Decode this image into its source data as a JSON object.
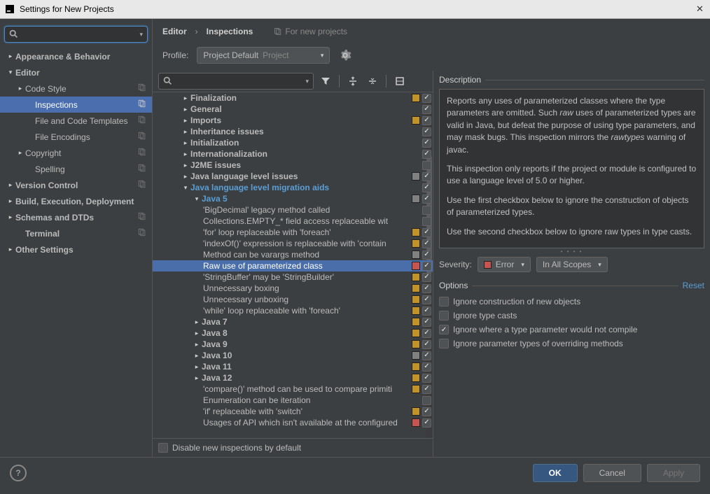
{
  "title": "Settings for New Projects",
  "crumbs": {
    "a": "Editor",
    "b": "Inspections",
    "sub": "For new projects"
  },
  "profile": {
    "label": "Profile:",
    "name": "Project Default",
    "scope": "Project"
  },
  "sidebar": {
    "items": [
      {
        "lbl": "Appearance & Behavior",
        "tri": "closed",
        "bold": true,
        "ind": 0,
        "copy": false
      },
      {
        "lbl": "Editor",
        "tri": "open",
        "bold": true,
        "ind": 0,
        "copy": false
      },
      {
        "lbl": "Code Style",
        "tri": "closed",
        "bold": false,
        "ind": 1,
        "copy": true
      },
      {
        "lbl": "Inspections",
        "tri": "none",
        "bold": false,
        "ind": 2,
        "sel": true,
        "copy": true
      },
      {
        "lbl": "File and Code Templates",
        "tri": "none",
        "bold": false,
        "ind": 2,
        "copy": true
      },
      {
        "lbl": "File Encodings",
        "tri": "none",
        "bold": false,
        "ind": 2,
        "copy": true
      },
      {
        "lbl": "Copyright",
        "tri": "closed",
        "bold": false,
        "ind": 1,
        "copy": true
      },
      {
        "lbl": "Spelling",
        "tri": "none",
        "bold": false,
        "ind": 2,
        "copy": true
      },
      {
        "lbl": "Version Control",
        "tri": "closed",
        "bold": true,
        "ind": 0,
        "copy": true
      },
      {
        "lbl": "Build, Execution, Deployment",
        "tri": "closed",
        "bold": true,
        "ind": 0,
        "copy": false
      },
      {
        "lbl": "Schemas and DTDs",
        "tri": "closed",
        "bold": true,
        "ind": 0,
        "copy": true
      },
      {
        "lbl": "Terminal",
        "tri": "none",
        "bold": true,
        "ind": 1,
        "copy": true
      },
      {
        "lbl": "Other Settings",
        "tri": "closed",
        "bold": true,
        "ind": 0,
        "copy": false
      }
    ]
  },
  "inspections": [
    {
      "d": 2,
      "tri": "closed",
      "lbl": "Finalization",
      "bold": true,
      "sev": "orange",
      "chk": true
    },
    {
      "d": 2,
      "tri": "closed",
      "lbl": "General",
      "bold": true,
      "sev": "none",
      "chk": true
    },
    {
      "d": 2,
      "tri": "closed",
      "lbl": "Imports",
      "bold": true,
      "sev": "orange",
      "chk": true
    },
    {
      "d": 2,
      "tri": "closed",
      "lbl": "Inheritance issues",
      "bold": true,
      "sev": "none",
      "chk": true
    },
    {
      "d": 2,
      "tri": "closed",
      "lbl": "Initialization",
      "bold": true,
      "sev": "none",
      "chk": true
    },
    {
      "d": 2,
      "tri": "closed",
      "lbl": "Internationalization",
      "bold": true,
      "sev": "none",
      "chk": true
    },
    {
      "d": 2,
      "tri": "closed",
      "lbl": "J2ME issues",
      "bold": true,
      "sev": "none",
      "chk": false
    },
    {
      "d": 2,
      "tri": "closed",
      "lbl": "Java language level issues",
      "bold": true,
      "sev": "gray",
      "chk": true
    },
    {
      "d": 2,
      "tri": "open",
      "lbl": "Java language level migration aids",
      "bold": true,
      "blue": true,
      "sev": "none",
      "chk": true
    },
    {
      "d": 3,
      "tri": "open",
      "lbl": "Java 5",
      "bold": true,
      "blue": true,
      "sev": "gray",
      "chk": true
    },
    {
      "d": 4,
      "lbl": "'BigDecimal' legacy method called",
      "sev": "none",
      "chk": false
    },
    {
      "d": 4,
      "lbl": "Collections.EMPTY_* field access replaceable wit",
      "sev": "none",
      "chk": false
    },
    {
      "d": 4,
      "lbl": "'for' loop replaceable with 'foreach'",
      "sev": "orange",
      "chk": true
    },
    {
      "d": 4,
      "lbl": "'indexOf()' expression is replaceable with 'contain",
      "sev": "orange",
      "chk": true
    },
    {
      "d": 4,
      "lbl": "Method can be varargs method",
      "sev": "gray",
      "chk": true
    },
    {
      "d": 4,
      "lbl": "Raw use of parameterized class",
      "sev": "red",
      "chk": true,
      "sel": true
    },
    {
      "d": 4,
      "lbl": "'StringBuffer' may be 'StringBuilder'",
      "sev": "orange",
      "chk": true
    },
    {
      "d": 4,
      "lbl": "Unnecessary boxing",
      "sev": "orange",
      "chk": true
    },
    {
      "d": 4,
      "lbl": "Unnecessary unboxing",
      "sev": "orange",
      "chk": true
    },
    {
      "d": 4,
      "lbl": "'while' loop replaceable with 'foreach'",
      "sev": "orange",
      "chk": true
    },
    {
      "d": 3,
      "tri": "closed",
      "lbl": "Java 7",
      "bold": true,
      "sev": "orange",
      "chk": true
    },
    {
      "d": 3,
      "tri": "closed",
      "lbl": "Java 8",
      "bold": true,
      "sev": "orange",
      "chk": true
    },
    {
      "d": 3,
      "tri": "closed",
      "lbl": "Java 9",
      "bold": true,
      "sev": "orange",
      "chk": true
    },
    {
      "d": 3,
      "tri": "closed",
      "lbl": "Java 10",
      "bold": true,
      "sev": "gray",
      "chk": true
    },
    {
      "d": 3,
      "tri": "closed",
      "lbl": "Java 11",
      "bold": true,
      "sev": "orange",
      "chk": true
    },
    {
      "d": 3,
      "tri": "closed",
      "lbl": "Java 12",
      "bold": true,
      "sev": "orange",
      "chk": true
    },
    {
      "d": 4,
      "lbl": "'compare()' method can be used to compare primiti",
      "sev": "orange",
      "chk": true
    },
    {
      "d": 4,
      "lbl": "Enumeration can be iteration",
      "sev": "none",
      "chk": false
    },
    {
      "d": 4,
      "lbl": "'if' replaceable with 'switch'",
      "sev": "orange",
      "chk": true
    },
    {
      "d": 4,
      "lbl": "Usages of API which isn't available at the configured",
      "sev": "red",
      "chk": true
    }
  ],
  "insp_footer": "Disable new inspections by default",
  "detail": {
    "desc_label": "Description",
    "p1a": "Reports any uses of parameterized classes where the type parameters are omitted. Such ",
    "p1b": "raw",
    "p1c": " uses of parameterized types are valid in Java, but defeat the purpose of using type parameters, and may mask bugs. This inspection mirrors the ",
    "p1d": "rawtypes",
    "p1e": " warning of javac.",
    "p2": "This inspection only reports if the project or module is configured to use a language level of 5.0 or higher.",
    "p3": "Use the first checkbox below to ignore the construction of objects of parameterized types.",
    "p4": "Use the second checkbox below to ignore raw types in type casts.",
    "sev_label": "Severity:",
    "sev": "Error",
    "scope": "In All Scopes",
    "opts_label": "Options",
    "reset": "Reset",
    "options": [
      {
        "lbl": "Ignore construction of new objects",
        "chk": false
      },
      {
        "lbl": "Ignore type casts",
        "chk": false
      },
      {
        "lbl": "Ignore where a type parameter would not compile",
        "chk": true
      },
      {
        "lbl": "Ignore parameter types of overriding methods",
        "chk": false
      }
    ]
  },
  "buttons": {
    "ok": "OK",
    "cancel": "Cancel",
    "apply": "Apply"
  }
}
